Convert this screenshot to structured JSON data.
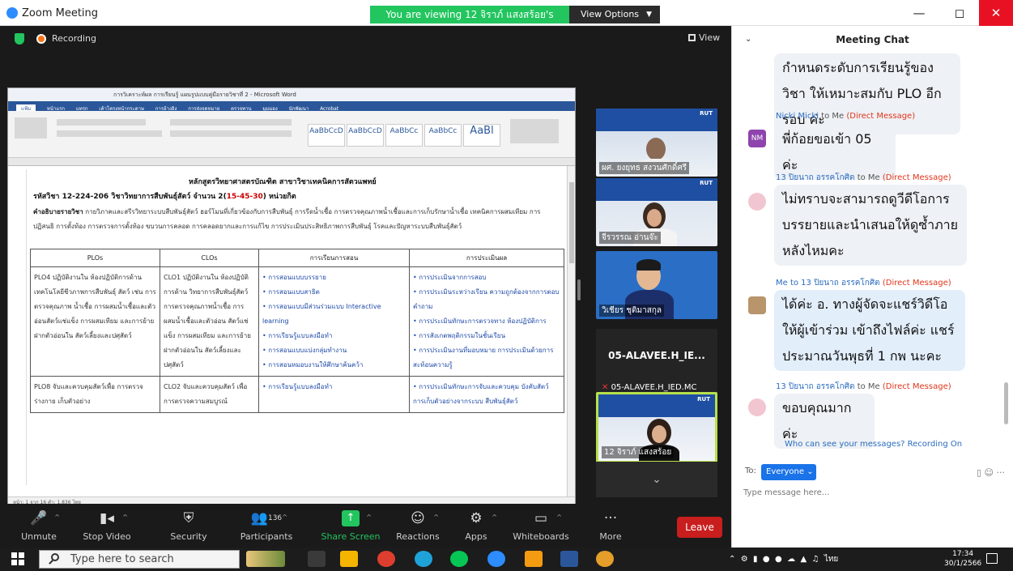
{
  "window": {
    "title": "Zoom Meeting",
    "banner": "You are viewing 12 จิราภ์ แสงสร้อย's screen",
    "view_options": "View Options"
  },
  "meeting": {
    "recording_label": "Recording",
    "view_label": "View"
  },
  "word": {
    "title": "การวิเคราะห์ผล การเรียนรู้ แผนรูปแบบคู่มือรายวิชาที่ 2 - Microsoft Word",
    "tabs": [
      "แฟ้ม",
      "หน้าแรก",
      "แทรก",
      "เค้าโครงหน้ากระดาษ",
      "การอ้างอิง",
      "การส่งจดหมาย",
      "ตรวจทาน",
      "มุมมอง",
      "นักพัฒนา",
      "Acrobat"
    ],
    "styles": [
      "AaBbCcD",
      "AaBbCcD",
      "AaBbCc",
      "AaBbCc",
      "AaBl"
    ],
    "status": "หน้า: 1 จาก 16    คำ: 1,836    ไทย",
    "doc": {
      "title": "หลักสูตรวิทยาศาสตรบัณฑิต สาขาวิชาเทคนิคการสัตวแพทย์",
      "code_prefix": "รหัสวิชา 12-224-206 วิชาวิทยาการสืบพันธุ์สัตว์ จำนวน 2(",
      "code_red": "15-45-30",
      "code_suffix": ") หน่วยกิต",
      "desc_label": "คำอธิบายรายวิชา",
      "desc_text": "กายวิภาคและสรีรวิทยาระบบสืบพันธุ์สัตว์ ฮอร์โมนที่เกี่ยวข้องกับการสืบพันธุ์ การรีดน้ำเชื้อ การตรวจคุณภาพน้ำเชื้อและการเก็บรักษาน้ำเชื้อ เทคนิคการผสมเทียม การปฏิสนธิ การตั้งท้อง การตรวจการตั้งท้อง ขบวนการคลอด การคลอดยากและการแก้ไข การประเมินประสิทธิภาพการสืบพันธุ์ โรคและปัญหาระบบสืบพันธุ์สัตว์",
      "headers": [
        "PLOs",
        "CLOs",
        "การเรียนการสอน",
        "การประเมินผล"
      ],
      "row1": {
        "plo": "PLO4 ปฏิบัติงานใน ห้องปฏิบัติการด้าน เทคโนโลยีชีวภาพการสืบพันธุ์ สัตว์ เช่น การตรวจคุณภาพ น้ำเชื้อ การผสมน้ำเชื้อและตัว อ่อนสัตว์แช่แข็ง การผสมเทียม และการย้ายฝากตัวอ่อนใน สัตว์เลี้ยงและปศุสัตว์",
        "clo": "CLO1 ปฏิบัติงานใน ห้องปฏิบัติการด้าน วิทยาการสืบพันธุ์สัตว์ การตรวจคุณภาพน้ำเชื้อ การผสมน้ำเชื้อและตัวอ่อน สัตว์แช่แข็ง การผสมเทียม และการย้ายฝากตัวอ่อนใน สัตว์เลี้ยงและปศุสัตว์",
        "teaching": [
          "การสอนแบบบรรยาย",
          "การสอนแบบสาธิต",
          "การสอนแบบมีส่วนร่วมแบบ Interactive learning",
          "การเรียนรู้แบบลงมือทำ",
          "การสอนแบบแบ่งกลุ่มทำงาน",
          "การสอนหมอบงานให้ศึกษาค้นคว้า"
        ],
        "eval": [
          "การประเมินจากการสอบ",
          "การประเมินระหว่างเรียน ความถูกต้องจากการตอบคำถาม",
          "การประเมินทักษะการตรวจทาง ห้องปฏิบัติการ",
          "การสังเกตพฤติกรรมในชั้นเรียน",
          "การประเมินงานที่มอบหมาย การประเมินด้วยการสะท้อนความรู้"
        ]
      },
      "row2": {
        "plo": "PLO8 จับและควบคุมสัตว์เพื่อ การตรวจร่างกาย เก็บตัวอย่าง",
        "clo": "CLO2 จับและควบคุมสัตว์ เพื่อการตรวจความสมบูรณ์",
        "teaching": [
          "การเรียนรู้แบบลงมือทำ"
        ],
        "eval": [
          "การประเมินทักษะการจับและควบคุม บังคับสัตว์ การเก็บตัวอย่างจากระบบ สืบพันธุ์สัตว์"
        ]
      }
    }
  },
  "tiles": [
    {
      "label": "ผศ. ยงยุทธ สงวนศักดิ์ศรี",
      "slide_tag": "RUT"
    },
    {
      "label": "จีรวรรณ อ่านจ๊ะ",
      "slide_tag": "RUT"
    },
    {
      "label": "วิเชียร ชุติมาสกุล"
    },
    {
      "label": "05-ALAVEE.H_IED.MC",
      "big_name": "05-ALAVEE.H_IE..."
    },
    {
      "label": "12 จิราภ์ แสงสร้อย",
      "slide_tag": "RUT"
    }
  ],
  "controls": {
    "unmute": "Unmute",
    "stop_video": "Stop Video",
    "security": "Security",
    "participants": "Participants",
    "participant_count": "136",
    "share_screen": "Share Screen",
    "reactions": "Reactions",
    "apps": "Apps",
    "whiteboards": "Whiteboards",
    "more": "More",
    "leave": "Leave"
  },
  "chat": {
    "title": "Meeting Chat",
    "messages": [
      {
        "text": "กำหนดระดับการเรียนรู้ของวิชา ให้เหมาะสมกับ PLO อีกรอบ ค่ะ"
      },
      {
        "sender": "Nicki Micki",
        "to": "to Me",
        "dm": "(Direct Message)",
        "avatar_initials": "NM",
        "text": "พี่ก้อยขอเข้า 05 ค่ะ"
      },
      {
        "sender": "13 ปิยนาถ อรรคโกศิต",
        "to": "to Me",
        "dm": "(Direct Message)",
        "text": "ไม่ทราบจะสามารถดูวีดีโอการ บรรยายและนำเสนอให้ดูซ้ำภาย หลังไหมคะ"
      },
      {
        "sender": "Me to 13 ปิยนาถ อรรคโกศิต",
        "dm": "(Direct Message)",
        "text": "ได้ค่ะ อ. ทางผู้จัดจะแชร์วิดีโอ ให้ผู้เข้าร่วม เข้าถึงไฟล์ค่ะ แชร์ ประมาณวันพุธที่ 1 กพ นะคะ"
      },
      {
        "sender": "13 ปิยนาถ อรรคโกศิต",
        "to": "to Me",
        "dm": "(Direct Message)",
        "text": "ขอบคุณมากค่ะ"
      }
    ],
    "who_can_see": "Who can see your messages? Recording On",
    "to_label": "To:",
    "to_value": "Everyone",
    "input_placeholder": "Type message here..."
  },
  "taskbar": {
    "search_placeholder": "Type here to search",
    "time": "17:34",
    "date": "30/1/2566",
    "lang": "ไทย"
  }
}
